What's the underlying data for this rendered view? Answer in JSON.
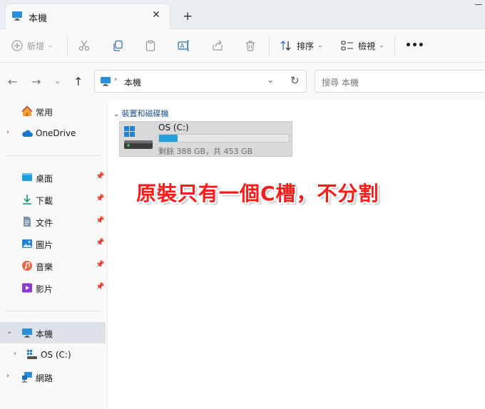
{
  "tab": {
    "title": "本機"
  },
  "toolbar": {
    "new_label": "新增",
    "sort_label": "排序",
    "view_label": "檢視",
    "more_label": "•••"
  },
  "address": {
    "location": "本機",
    "search_placeholder": "搜尋 本機"
  },
  "sidebar": {
    "top": [
      {
        "label": "常用",
        "icon": "home-icon"
      },
      {
        "label": "OneDrive",
        "icon": "cloud-icon"
      }
    ],
    "quick_access": [
      {
        "label": "桌面",
        "icon": "desktop-folder-icon"
      },
      {
        "label": "下載",
        "icon": "download-icon"
      },
      {
        "label": "文件",
        "icon": "document-icon"
      },
      {
        "label": "圖片",
        "icon": "picture-icon"
      },
      {
        "label": "音樂",
        "icon": "music-icon"
      },
      {
        "label": "影片",
        "icon": "video-icon"
      }
    ],
    "tree": [
      {
        "label": "本機",
        "icon": "computer-icon"
      },
      {
        "label": "OS (C:)",
        "icon": "drive-icon"
      },
      {
        "label": "網路",
        "icon": "network-icon"
      }
    ]
  },
  "main": {
    "group_header": "裝置和磁碟機",
    "drive": {
      "name": "OS (C:)",
      "space_text": "剩餘 388 GB，共 453 GB",
      "used_fraction": 0.143
    }
  },
  "annotation": "原裝只有一個C槽，不分割",
  "colors": {
    "accent": "#26a0da",
    "annotation": "#ff1a1a",
    "header": "#1f4e8c"
  }
}
